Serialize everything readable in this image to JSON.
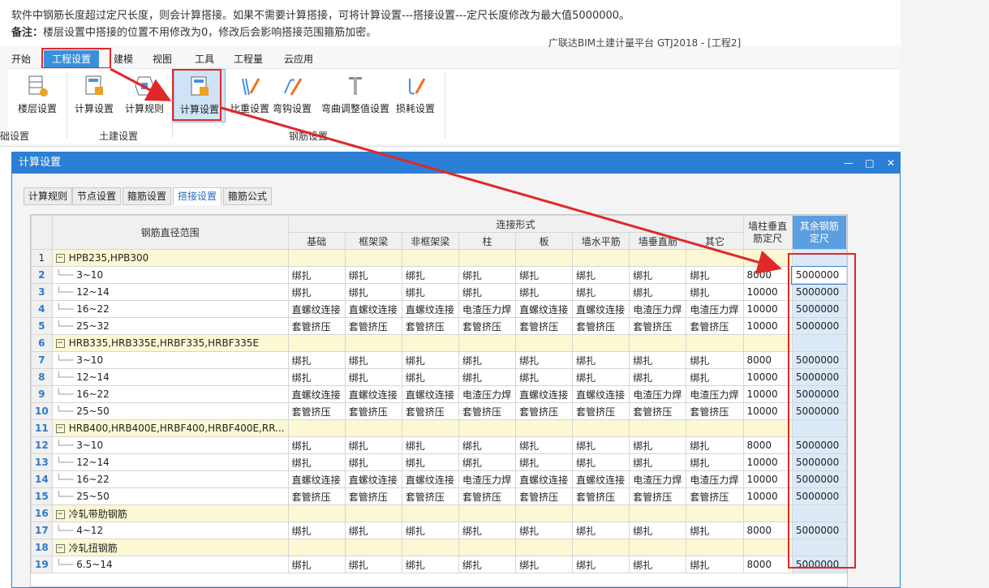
{
  "notes": {
    "line1": "软件中钢筋长度超过定尺长度，则会计算搭接。如果不需要计算搭接，可将计算设置---搭接设置---定尺长度修改为最大值5000000。",
    "line2_bold": "备注：",
    "line2_rest": "楼层设置中搭接的位置不用修改为0，修改后会影响搭接范围箍筋加密。"
  },
  "app_title": "广联达BIM土建计量平台 GTJ2018 - [工程2]",
  "menu": [
    "开始",
    "工程设置",
    "建模",
    "视图",
    "工具",
    "工程量",
    "云应用"
  ],
  "ribbon": {
    "tools": [
      "楼层设置",
      "计算设置",
      "计算规则",
      "计算设置",
      "比重设置",
      "弯钩设置",
      "弯曲调整值设置",
      "损耗设置"
    ],
    "groups": [
      "础设置",
      "土建设置",
      "钢筋设置"
    ]
  },
  "dialog": {
    "title": "计算设置",
    "controls": [
      "—",
      "□",
      "✕"
    ],
    "tabs": [
      "计算规则",
      "节点设置",
      "箍筋设置",
      "搭接设置",
      "箍筋公式"
    ]
  },
  "table": {
    "header_range": "钢筋直径范围",
    "header_group": "连接形式",
    "sub_headers": [
      "基础",
      "框架梁",
      "非框架梁",
      "柱",
      "板",
      "墙水平筋",
      "墙垂直筋",
      "其它"
    ],
    "header_wall": "墙柱垂直筋定尺",
    "header_other": "其余钢筋定尺",
    "rows": [
      {
        "no": "1",
        "group": true,
        "name": "HPB235,HPB300"
      },
      {
        "no": "2",
        "name": "3~10",
        "cells": [
          "绑扎",
          "绑扎",
          "绑扎",
          "绑扎",
          "绑扎",
          "绑扎",
          "绑扎",
          "绑扎"
        ],
        "wall": "8000",
        "other": "5000000"
      },
      {
        "no": "3",
        "name": "12~14",
        "cells": [
          "绑扎",
          "绑扎",
          "绑扎",
          "绑扎",
          "绑扎",
          "绑扎",
          "绑扎",
          "绑扎"
        ],
        "wall": "10000",
        "other": "5000000"
      },
      {
        "no": "4",
        "name": "16~22",
        "cells": [
          "直螺纹连接",
          "直螺纹连接",
          "直螺纹连接",
          "电渣压力焊",
          "直螺纹连接",
          "直螺纹连接",
          "电渣压力焊",
          "电渣压力焊"
        ],
        "wall": "10000",
        "other": "5000000"
      },
      {
        "no": "5",
        "name": "25~32",
        "cells": [
          "套管挤压",
          "套管挤压",
          "套管挤压",
          "套管挤压",
          "套管挤压",
          "套管挤压",
          "套管挤压",
          "套管挤压"
        ],
        "wall": "10000",
        "other": "5000000"
      },
      {
        "no": "6",
        "group": true,
        "name": "HRB335,HRB335E,HRBF335,HRBF335E"
      },
      {
        "no": "7",
        "name": "3~10",
        "cells": [
          "绑扎",
          "绑扎",
          "绑扎",
          "绑扎",
          "绑扎",
          "绑扎",
          "绑扎",
          "绑扎"
        ],
        "wall": "8000",
        "other": "5000000"
      },
      {
        "no": "8",
        "name": "12~14",
        "cells": [
          "绑扎",
          "绑扎",
          "绑扎",
          "绑扎",
          "绑扎",
          "绑扎",
          "绑扎",
          "绑扎"
        ],
        "wall": "10000",
        "other": "5000000"
      },
      {
        "no": "9",
        "name": "16~22",
        "cells": [
          "直螺纹连接",
          "直螺纹连接",
          "直螺纹连接",
          "电渣压力焊",
          "直螺纹连接",
          "直螺纹连接",
          "电渣压力焊",
          "电渣压力焊"
        ],
        "wall": "10000",
        "other": "5000000"
      },
      {
        "no": "10",
        "name": "25~50",
        "cells": [
          "套管挤压",
          "套管挤压",
          "套管挤压",
          "套管挤压",
          "套管挤压",
          "套管挤压",
          "套管挤压",
          "套管挤压"
        ],
        "wall": "10000",
        "other": "5000000"
      },
      {
        "no": "11",
        "group": true,
        "name": "HRB400,HRB400E,HRBF400,HRBF400E,RR..."
      },
      {
        "no": "12",
        "name": "3~10",
        "cells": [
          "绑扎",
          "绑扎",
          "绑扎",
          "绑扎",
          "绑扎",
          "绑扎",
          "绑扎",
          "绑扎"
        ],
        "wall": "8000",
        "other": "5000000"
      },
      {
        "no": "13",
        "name": "12~14",
        "cells": [
          "绑扎",
          "绑扎",
          "绑扎",
          "绑扎",
          "绑扎",
          "绑扎",
          "绑扎",
          "绑扎"
        ],
        "wall": "10000",
        "other": "5000000"
      },
      {
        "no": "14",
        "name": "16~22",
        "cells": [
          "直螺纹连接",
          "直螺纹连接",
          "直螺纹连接",
          "电渣压力焊",
          "直螺纹连接",
          "直螺纹连接",
          "电渣压力焊",
          "电渣压力焊"
        ],
        "wall": "10000",
        "other": "5000000"
      },
      {
        "no": "15",
        "name": "25~50",
        "cells": [
          "套管挤压",
          "套管挤压",
          "套管挤压",
          "套管挤压",
          "套管挤压",
          "套管挤压",
          "套管挤压",
          "套管挤压"
        ],
        "wall": "10000",
        "other": "5000000"
      },
      {
        "no": "16",
        "group": true,
        "name": "冷轧带肋钢筋"
      },
      {
        "no": "17",
        "name": "4~12",
        "cells": [
          "绑扎",
          "绑扎",
          "绑扎",
          "绑扎",
          "绑扎",
          "绑扎",
          "绑扎",
          "绑扎"
        ],
        "wall": "8000",
        "other": "5000000"
      },
      {
        "no": "18",
        "group": true,
        "name": "冷轧扭钢筋"
      },
      {
        "no": "19",
        "name": "6.5~14",
        "cells": [
          "绑扎",
          "绑扎",
          "绑扎",
          "绑扎",
          "绑扎",
          "绑扎",
          "绑扎",
          "绑扎"
        ],
        "wall": "8000",
        "other": "5000000"
      }
    ]
  },
  "colors": {
    "accent": "#2b7fd4",
    "annotation_red": "#e02828",
    "group_row": "#fbf8d3",
    "selected_column": "#dceaf8"
  }
}
